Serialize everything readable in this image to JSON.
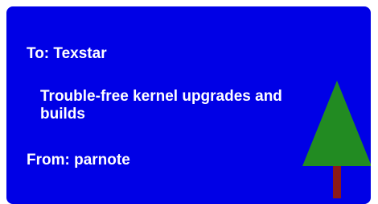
{
  "card": {
    "to_line": "To: Texstar",
    "message": "Trouble-free kernel upgrades and builds",
    "from_line": "From: parnote",
    "background_color": "#0000e6",
    "text_color": "#ffffff"
  },
  "tree": {
    "icon": "pine-tree-icon",
    "foliage_color": "#228b22",
    "trunk_color": "#8b1a1a"
  }
}
